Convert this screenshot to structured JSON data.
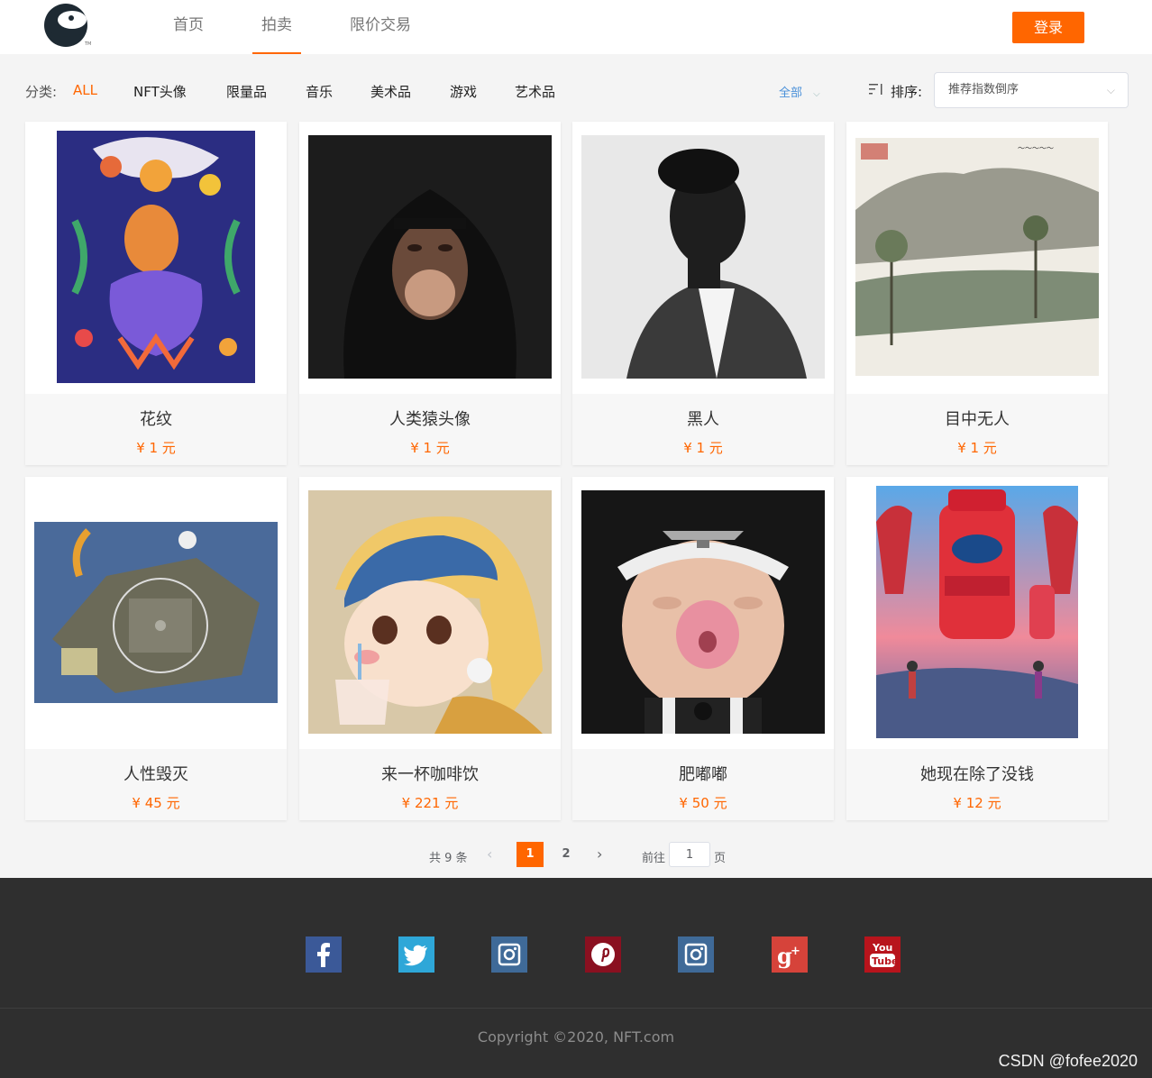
{
  "header": {
    "nav": [
      {
        "label": "首页",
        "active": false
      },
      {
        "label": "拍卖",
        "active": true
      },
      {
        "label": "限价交易",
        "active": false
      }
    ],
    "login_label": "登录"
  },
  "filters": {
    "category_label": "分类:",
    "categories": [
      "ALL",
      "NFT头像",
      "限量品",
      "音乐",
      "美术品",
      "游戏",
      "艺术品"
    ],
    "active_category": "ALL",
    "scope_label": "全部",
    "sort_label": "排序:",
    "sort_value": "推荐指数倒序"
  },
  "products": [
    {
      "name": "花纹",
      "price": "¥ 1 元"
    },
    {
      "name": "人类猿头像",
      "price": "¥ 1 元"
    },
    {
      "name": "黑人",
      "price": "¥ 1 元"
    },
    {
      "name": "目中无人",
      "price": "¥ 1 元"
    },
    {
      "name": "人性毁灭",
      "price": "¥ 45 元"
    },
    {
      "name": "来一杯咖啡饮",
      "price": "¥ 221 元"
    },
    {
      "name": "肥嘟嘟",
      "price": "¥ 50 元"
    },
    {
      "name": "她现在除了没钱",
      "price": "¥ 12 元"
    }
  ],
  "pagination": {
    "total": "共 9 条",
    "pages": [
      "1",
      "2"
    ],
    "current": "1",
    "goto_label": "前往",
    "goto_value": "1",
    "page_unit": "页"
  },
  "footer": {
    "social": [
      {
        "icon": "facebook-icon",
        "color": "#3b5998"
      },
      {
        "icon": "twitter-icon",
        "color": "#1da1f2"
      },
      {
        "icon": "instagram-icon",
        "color": "#3f729b"
      },
      {
        "icon": "pinterest-icon",
        "color": "#bd081c"
      },
      {
        "icon": "instagram-icon",
        "color": "#3f729b"
      },
      {
        "icon": "google-plus-icon",
        "color": "#dd4b39"
      },
      {
        "icon": "youtube-icon",
        "color": "#e62117"
      }
    ],
    "copyright": "Copyright ©2020, NFT.com",
    "watermark": "CSDN @fofee2020"
  },
  "colors": {
    "accent": "#ff6600",
    "link": "#4a90d9",
    "footer_bg": "#2f2f2f"
  }
}
